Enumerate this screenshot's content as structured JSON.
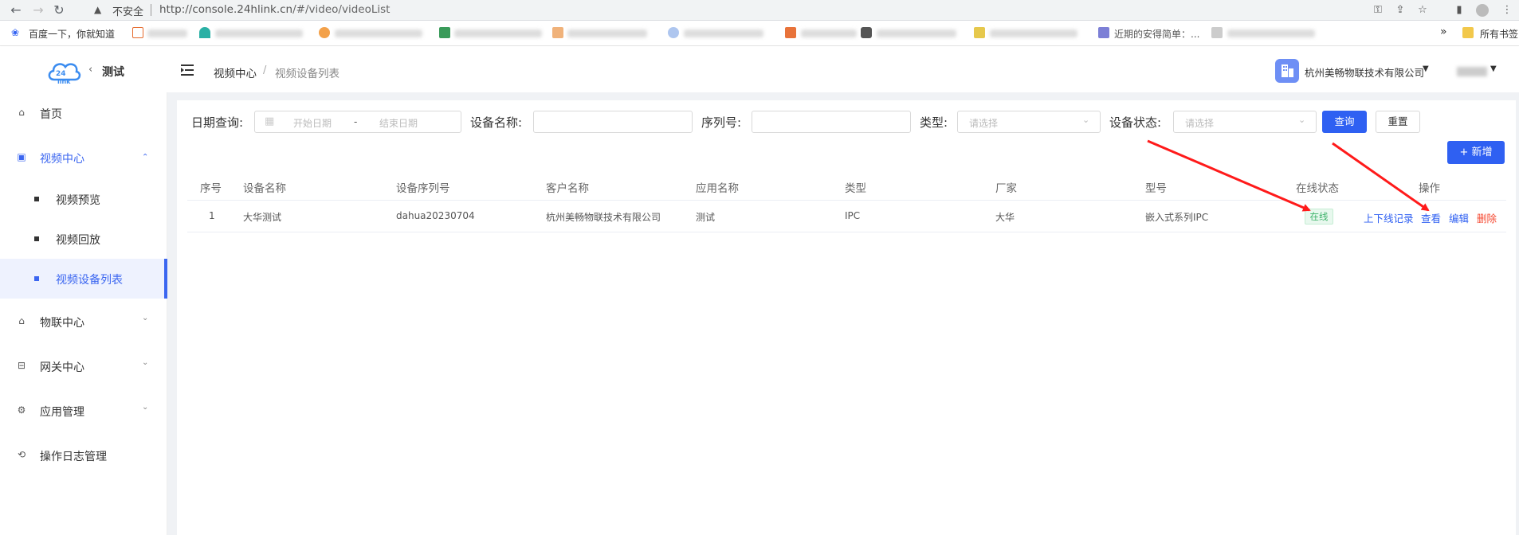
{
  "browser": {
    "insecure_label": "不安全",
    "url_host": "http://console.24hlink.cn",
    "url_path": "/#/video/videoList",
    "bookmark_first": "百度一下，你就知道",
    "bookmark_partial": "近期的安得简单：...",
    "bookmark_all": "所有书签",
    "more_indicator": "»"
  },
  "header": {
    "app_title": "测试",
    "back_chevron": "‹",
    "breadcrumb": [
      "视频中心",
      "视频设备列表"
    ],
    "breadcrumb_sep": "/",
    "company": "杭州美畅物联技术有限公司",
    "caret": "▼"
  },
  "sidebar": {
    "items": [
      {
        "label": "首页",
        "icon": "home-icon"
      },
      {
        "label": "视频中心",
        "icon": "video-icon",
        "expanded": true
      },
      {
        "label": "物联中心",
        "icon": "iot-icon"
      },
      {
        "label": "网关中心",
        "icon": "gateway-icon"
      },
      {
        "label": "应用管理",
        "icon": "gear-icon"
      },
      {
        "label": "操作日志管理",
        "icon": "log-icon"
      }
    ],
    "sub_items": [
      {
        "label": "视频预览"
      },
      {
        "label": "视频回放"
      },
      {
        "label": "视频设备列表",
        "active": true
      }
    ]
  },
  "filters": {
    "date_label": "日期查询:",
    "start_placeholder": "开始日期",
    "date_sep": "-",
    "end_placeholder": "结束日期",
    "device_name_label": "设备名称:",
    "serial_label": "序列号:",
    "type_label": "类型:",
    "type_placeholder": "请选择",
    "status_label": "设备状态:",
    "status_placeholder": "请选择",
    "query_button": "查询",
    "reset_button": "重置",
    "add_button": "+ 新增"
  },
  "table": {
    "columns": [
      "序号",
      "设备名称",
      "设备序列号",
      "客户名称",
      "应用名称",
      "类型",
      "厂家",
      "型号",
      "在线状态",
      "操作"
    ],
    "rows": [
      {
        "index": "1",
        "device_name": "大华测试",
        "serial": "dahua20230704",
        "customer": "杭州美畅物联技术有限公司",
        "app": "测试",
        "type": "IPC",
        "vendor": "大华",
        "model": "嵌入式系列IPC",
        "status": "在线",
        "actions": [
          "上下线记录",
          "查看",
          "编辑",
          "删除"
        ]
      }
    ]
  },
  "colors": {
    "accent": "#2f60f2",
    "online": "#3fb36b",
    "danger": "#f5472f",
    "annotation": "#ff1a1a"
  }
}
